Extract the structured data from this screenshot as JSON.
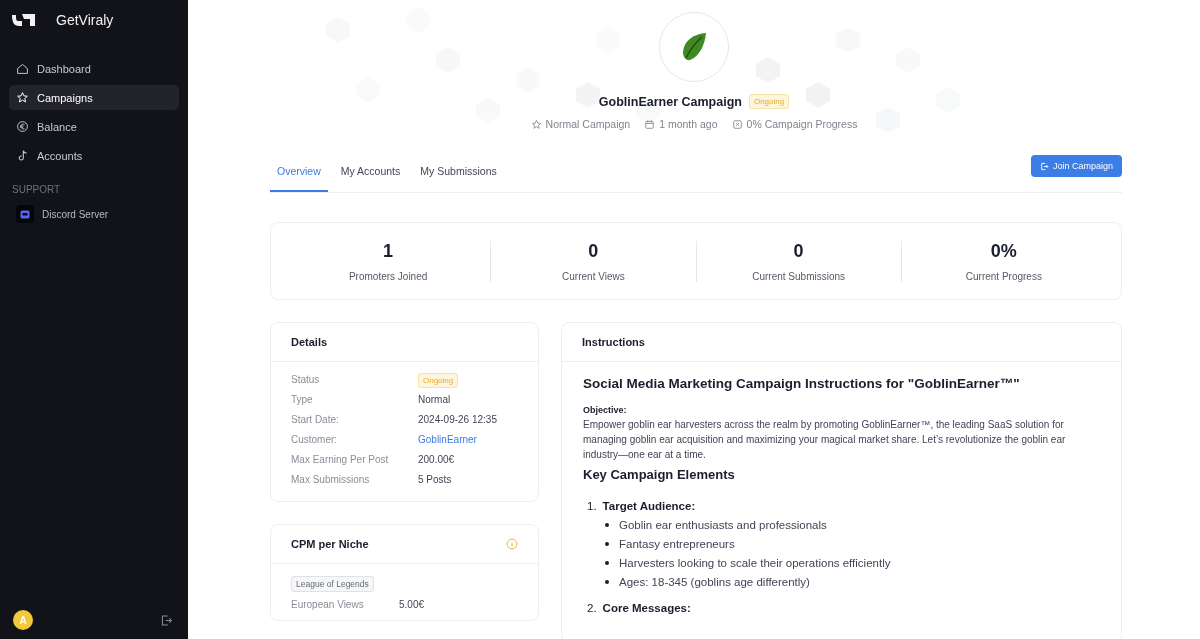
{
  "sidebar": {
    "brand": "GetViraly",
    "items": [
      {
        "label": "Dashboard",
        "kind": "home",
        "selected": false
      },
      {
        "label": "Campaigns",
        "kind": "star",
        "selected": true
      },
      {
        "label": "Balance",
        "kind": "euro",
        "selected": false
      },
      {
        "label": "Accounts",
        "kind": "note",
        "selected": false
      }
    ],
    "section": "SUPPORT",
    "support_items": [
      {
        "label": "Discord Server"
      }
    ],
    "user_initial": "A"
  },
  "header": {
    "title": "GoblinEarner Campaign",
    "status": "Ongoing",
    "meta": [
      {
        "kind": "star",
        "text": "Normal Campaign"
      },
      {
        "kind": "calendar",
        "text": "1 month ago"
      },
      {
        "kind": "progress",
        "text": "0% Campaign Progress"
      }
    ]
  },
  "tabs": [
    {
      "label": "Overview",
      "selected": true
    },
    {
      "label": "My Accounts",
      "selected": false
    },
    {
      "label": "My Submissions",
      "selected": false
    }
  ],
  "join_button": "Join Campaign",
  "stats": [
    {
      "value": "1",
      "label": "Promoters Joined"
    },
    {
      "value": "0",
      "label": "Current Views"
    },
    {
      "value": "0",
      "label": "Current Submissions"
    },
    {
      "value": "0%",
      "label": "Current Progress"
    }
  ],
  "details": {
    "title": "Details",
    "rows": [
      {
        "label": "Status",
        "value": "Ongoing",
        "kind": "badge"
      },
      {
        "label": "Type",
        "value": "Normal",
        "kind": "text"
      },
      {
        "label": "Start Date:",
        "value": "2024-09-26 12:35",
        "kind": "text"
      },
      {
        "label": "Customer:",
        "value": "GoblinEarner",
        "kind": "link"
      },
      {
        "label": "Max Earning Per Post",
        "value": "200.00€",
        "kind": "text"
      },
      {
        "label": "Max Submissions",
        "value": "5 Posts",
        "kind": "text"
      }
    ]
  },
  "cpm": {
    "title": "CPM per Niche",
    "niche": "League of Legends",
    "rows": [
      {
        "label": "European Views",
        "value": "5.00€"
      }
    ]
  },
  "instructions": {
    "title": "Instructions",
    "heading": "Social Media Marketing Campaign Instructions for \"GoblinEarner™\"",
    "objective_label": "Objective:",
    "objective": "Empower goblin ear harvesters across the realm by promoting GoblinEarner™, the leading SaaS solution for managing goblin ear acquisition and maximizing your magical market share. Let’s revolutionize the goblin ear industry—one ear at a time.",
    "subheading": "Key Campaign Elements",
    "elements": [
      {
        "number": "1.",
        "title": "Target Audience:",
        "bullets": [
          "Goblin ear enthusiasts and professionals",
          "Fantasy entrepreneurs",
          "Harvesters looking to scale their operations efficiently",
          "Ages: 18-345 (goblins age differently)"
        ]
      },
      {
        "number": "2.",
        "title": "Core Messages:"
      }
    ]
  }
}
